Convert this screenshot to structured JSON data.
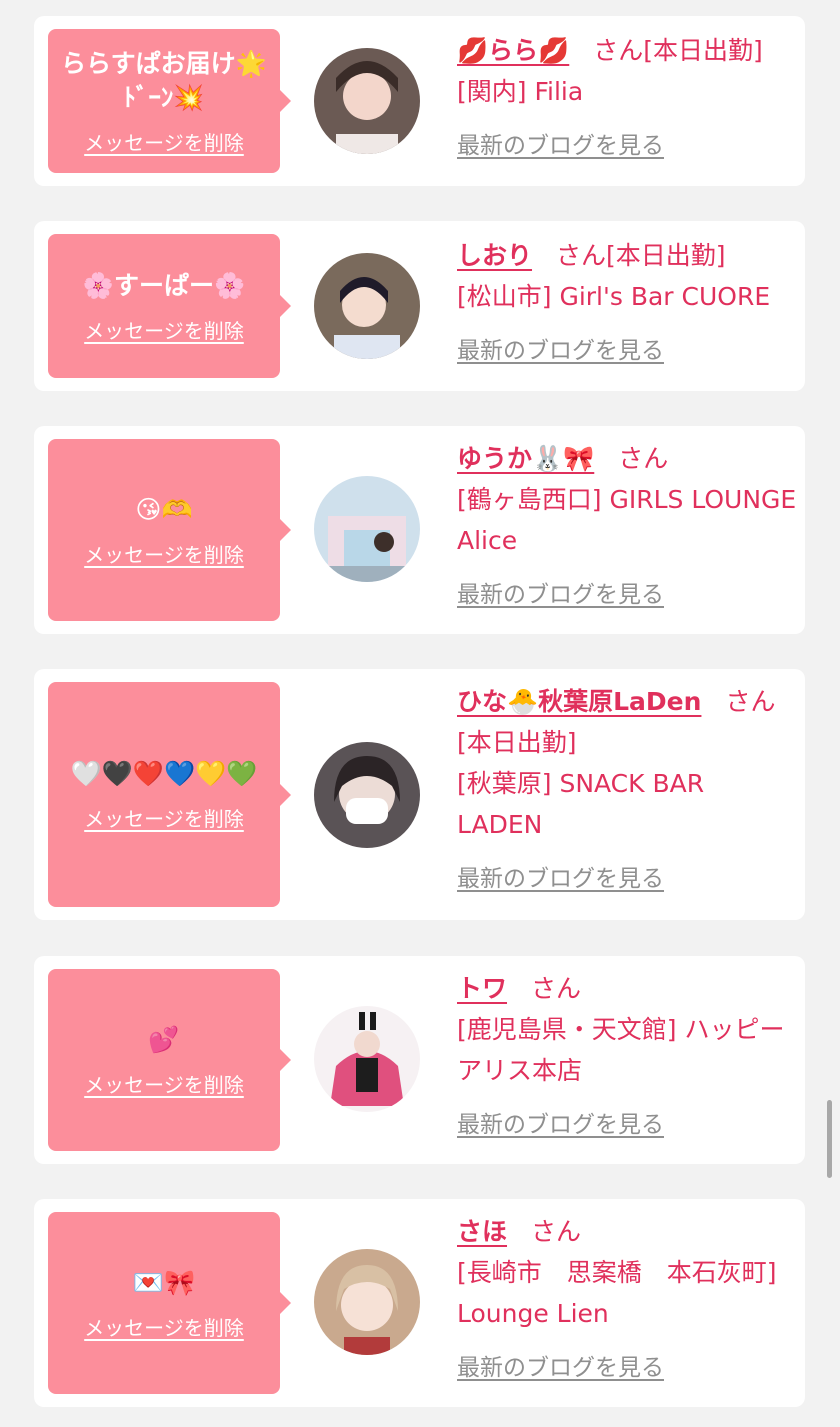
{
  "messages": [
    {
      "bubble_text": "ららすぱお届け🌟\nﾄﾞｰﾝ💥",
      "delete_label": "メッセージを削除",
      "name": "💋らら💋",
      "honorific": "さん[本日出勤]",
      "shop": "[関内] Filia",
      "blog_label": "最新のブログを見る",
      "avatar_icon": "profile-photo"
    },
    {
      "bubble_text": "🌸すーぱー🌸",
      "delete_label": "メッセージを削除",
      "name": "しおり",
      "honorific": "さん[本日出勤]",
      "shop": "[松山市] Girl's Bar CUORE",
      "blog_label": "最新のブログを見る",
      "avatar_icon": "profile-photo"
    },
    {
      "bubble_text": "😘🫶",
      "delete_label": "メッセージを削除",
      "name": "ゆうか🐰🎀",
      "honorific": "さん",
      "shop": "[鶴ヶ島西口] GIRLS LOUNGE Alice",
      "blog_label": "最新のブログを見る",
      "avatar_icon": "profile-photo"
    },
    {
      "bubble_text": "🤍🖤❤️💙💛💚",
      "delete_label": "メッセージを削除",
      "name": "ひな🐣秋葉原LaDen",
      "honorific": "さん[本日出勤]",
      "shop": "[秋葉原] SNACK BAR LADEN",
      "blog_label": "最新のブログを見る",
      "avatar_icon": "profile-photo"
    },
    {
      "bubble_text": "💕",
      "delete_label": "メッセージを削除",
      "name": "トワ",
      "honorific": "さん",
      "shop": "[鹿児島県・天文館] ハッピーアリス本店",
      "blog_label": "最新のブログを見る",
      "avatar_icon": "profile-photo"
    },
    {
      "bubble_text": "💌🎀",
      "delete_label": "メッセージを削除",
      "name": "さほ",
      "honorific": "さん",
      "shop": "[長崎市　思案橋　本石灰町] Lounge Lien",
      "blog_label": "最新のブログを見る",
      "avatar_icon": "profile-photo"
    }
  ],
  "colors": {
    "page_bg": "#f2f2f2",
    "card_bg": "#ffffff",
    "bubble": "#fc8e9b",
    "accent_text": "#e0305c",
    "link_gray": "#8f8f8f"
  }
}
